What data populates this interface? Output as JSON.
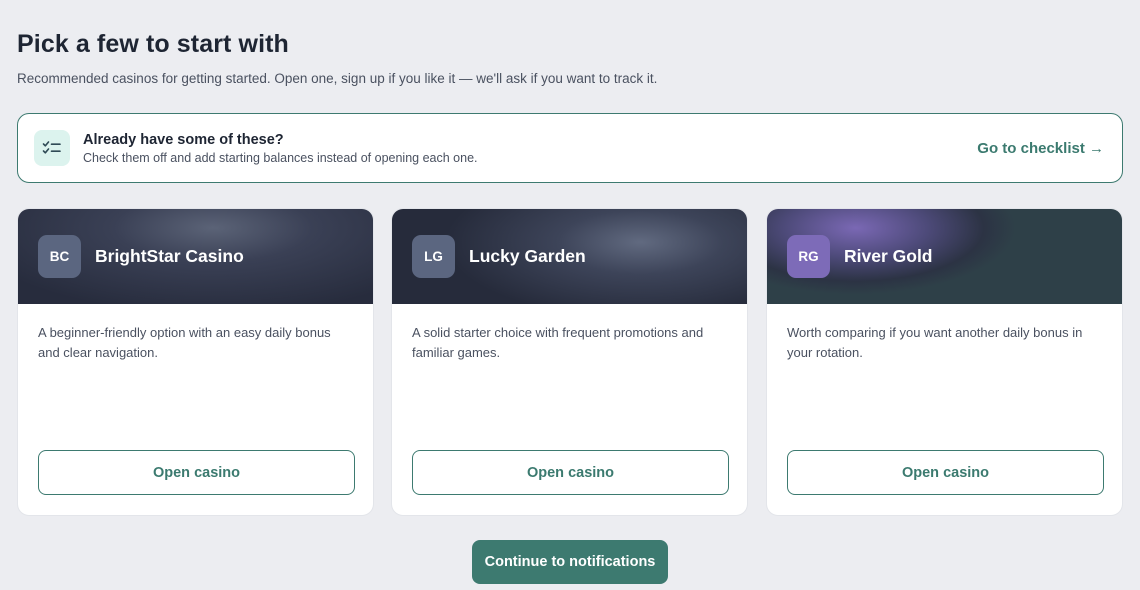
{
  "header": {
    "title": "Pick a few to start with",
    "subtitle": "Recommended casinos for getting started. Open one, sign up if you like it — we'll ask if you want to track it."
  },
  "banner": {
    "icon": "checklist-icon",
    "title": "Already have some of these?",
    "description": "Check them off and add starting balances instead of opening each one.",
    "link_label": "Go to checklist →"
  },
  "cards": [
    {
      "initials": "BC",
      "name": "BrightStar Casino",
      "description": "A beginner-friendly option with an easy daily bonus and clear navigation.",
      "button_label": "Open casino"
    },
    {
      "initials": "LG",
      "name": "Lucky Garden",
      "description": "A solid starter choice with frequent promotions and familiar games.",
      "button_label": "Open casino"
    },
    {
      "initials": "RG",
      "name": "River Gold",
      "description": "Worth comparing if you want another daily bonus in your rotation.",
      "button_label": "Open casino"
    }
  ],
  "footer": {
    "continue_label": "Continue to notifications"
  },
  "colors": {
    "accent": "#3d7a70",
    "background": "#ecedf1",
    "badge_bc": "#5b6680",
    "badge_lg": "#5b6680",
    "badge_rg": "#7d6bb8"
  }
}
